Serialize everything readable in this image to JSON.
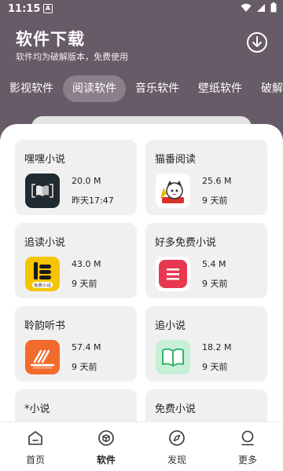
{
  "status_bar": {
    "time": "11:15",
    "notice_glyph": "A"
  },
  "header": {
    "title": "软件下载",
    "subtitle": "软件均为破解版本，免费使用",
    "download_icon": "download-icon"
  },
  "tabs": [
    {
      "label": "影视软件",
      "active": false
    },
    {
      "label": "阅读软件",
      "active": true
    },
    {
      "label": "音乐软件",
      "active": false
    },
    {
      "label": "壁纸软件",
      "active": false
    },
    {
      "label": "破解",
      "active": false
    }
  ],
  "apps": [
    {
      "name": "嘿嘿小说",
      "size": "20.0 M",
      "time": "昨天17:47",
      "icon": "book-open-icon",
      "icon_bg": "#1f2b30"
    },
    {
      "name": "猫番阅读",
      "size": "25.6 M",
      "time": "9 天前",
      "icon": "cat-mascot-icon",
      "icon_bg": "#ffffff"
    },
    {
      "name": "追读小说",
      "size": "43.0 M",
      "time": "9 天前",
      "icon": "book-stack-icon",
      "icon_bg": "#f5c400",
      "icon_caption": "免费小说"
    },
    {
      "name": "好多免费小说",
      "size": "5.4 M",
      "time": "9 天前",
      "icon": "book-lines-icon",
      "icon_bg": "#e8384f"
    },
    {
      "name": "聆韵听书",
      "size": "57.4 M",
      "time": "9 天前",
      "icon": "audio-book-icon",
      "icon_bg": "#f26b2c"
    },
    {
      "name": "追小说",
      "size": "18.2 M",
      "time": "9 天前",
      "icon": "open-book-icon",
      "icon_bg": "#c8efd8"
    },
    {
      "name": "*小说",
      "size": "",
      "time": "",
      "icon": "",
      "icon_bg": ""
    },
    {
      "name": "免费小说",
      "size": "",
      "time": "",
      "icon": "",
      "icon_bg": ""
    }
  ],
  "bottom_nav": [
    {
      "label": "首页",
      "icon": "home-icon",
      "active": false
    },
    {
      "label": "软件",
      "icon": "cube-icon",
      "active": true
    },
    {
      "label": "发现",
      "icon": "compass-icon",
      "active": false
    },
    {
      "label": "更多",
      "icon": "user-icon",
      "active": false
    }
  ],
  "colors": {
    "header_bg": "#665b66",
    "active_tab_bg": "#8a7f8a",
    "card_bg": "#f0f0f0"
  }
}
